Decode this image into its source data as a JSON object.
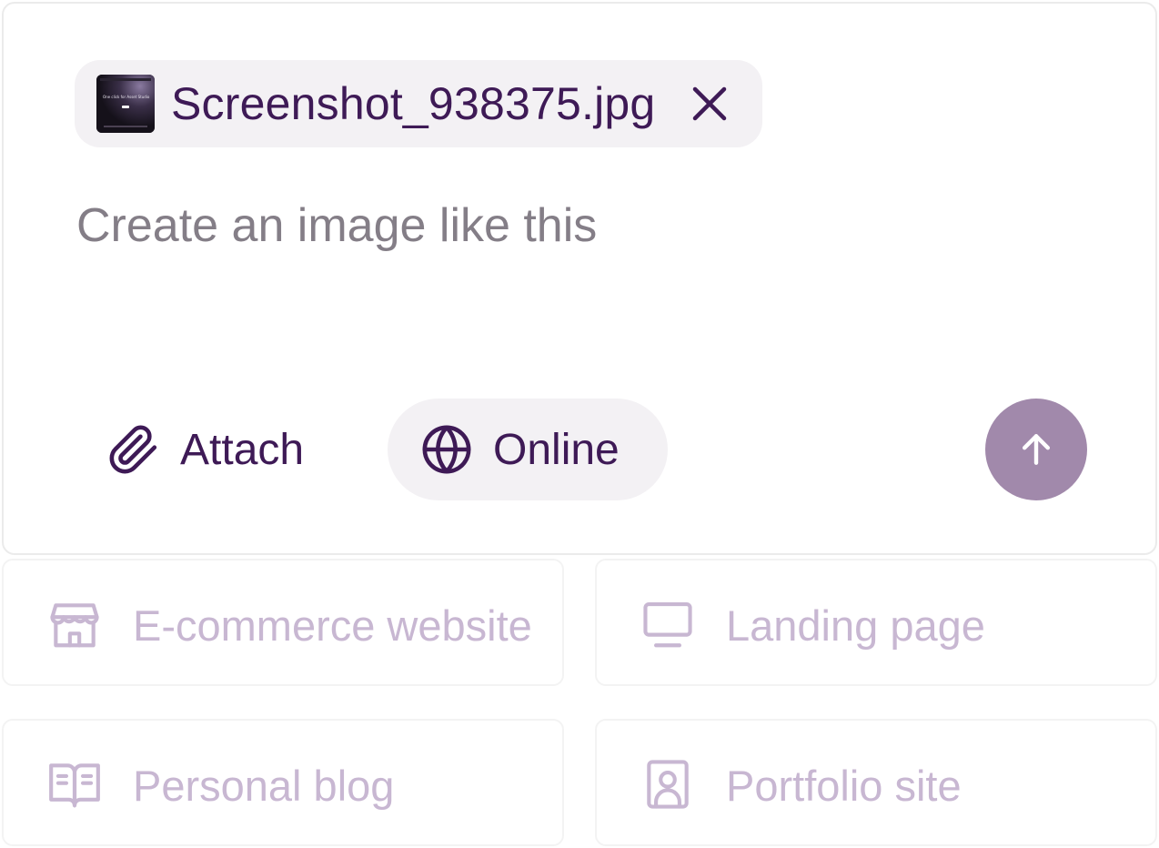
{
  "composer": {
    "attachment": {
      "file_name": "Screenshot_938375.jpg",
      "thumbnail_caption": "One click for Asset Studio",
      "remove_icon": "close-icon"
    },
    "prompt": {
      "value": "",
      "placeholder": "Create an image like this"
    },
    "toolbar": {
      "attach_label": "Attach",
      "attach_icon": "paperclip-icon",
      "online_label": "Online",
      "online_icon": "globe-icon",
      "send_icon": "arrow-up-icon"
    }
  },
  "suggestions": [
    {
      "label": "E-commerce website",
      "icon": "storefront-icon"
    },
    {
      "label": "Landing page",
      "icon": "monitor-icon"
    },
    {
      "label": "Personal blog",
      "icon": "open-book-icon"
    },
    {
      "label": "Portfolio site",
      "icon": "profile-card-icon"
    }
  ],
  "colors": {
    "brand_text": "#3e1a56",
    "chip_background": "#f3f1f4",
    "send_button": "#a189ab",
    "placeholder_text": "#847e87",
    "suggestion_text": "#c8b7d2"
  }
}
